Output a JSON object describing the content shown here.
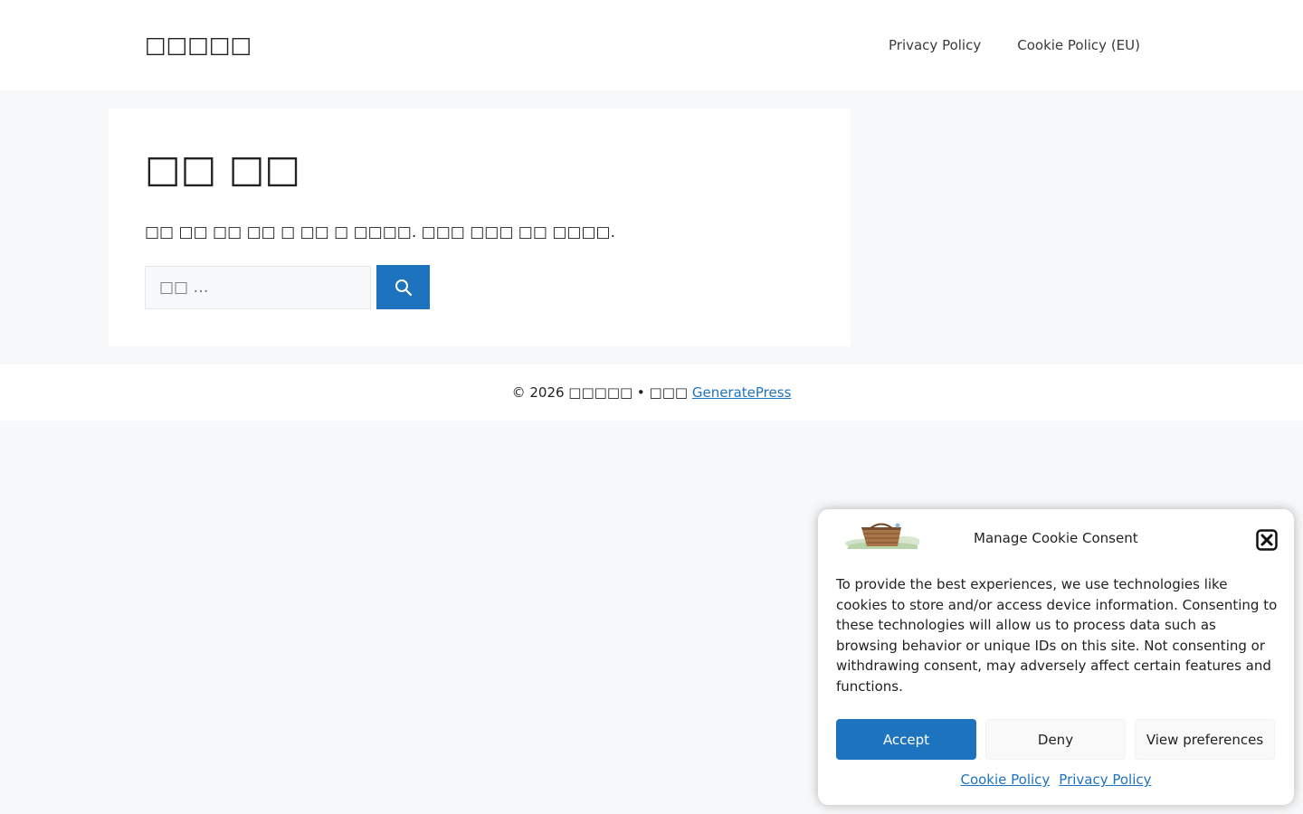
{
  "header": {
    "site_title": "□□□□□",
    "nav": [
      {
        "label": "Privacy Policy"
      },
      {
        "label": "Cookie Policy (EU)"
      }
    ]
  },
  "main": {
    "title": "□□ □□",
    "text": "□□ □□ □□ □□ □ □□ □ □□□□. □□□ □□□ □□ □□□□.",
    "search": {
      "placeholder": "□□ …"
    }
  },
  "footer": {
    "copyright_prefix": "© 2026 □□□□□ • □□□ ",
    "theme_link": "GeneratePress"
  },
  "cookie_banner": {
    "title": "Manage Cookie Consent",
    "message": "To provide the best experiences, we use technologies like cookies to store and/or access device information. Consenting to these technologies will allow us to process data such as browsing behavior or unique IDs on this site. Not consenting or withdrawing consent, may adversely affect certain features and functions.",
    "buttons": {
      "accept": "Accept",
      "deny": "Deny",
      "preferences": "View preferences"
    },
    "links": {
      "cookie_policy": "Cookie Policy",
      "privacy_policy": "Privacy Policy"
    }
  },
  "colors": {
    "accent": "#1e73be",
    "page_background": "#f7f8f9",
    "text": "#222222"
  }
}
